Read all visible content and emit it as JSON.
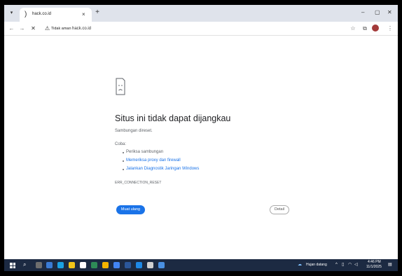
{
  "tab": {
    "title": "hack.co.id",
    "close": "×",
    "new_tab": "+"
  },
  "window": {
    "minimize": "–",
    "maximize": "▢",
    "close": "✕"
  },
  "toolbar": {
    "back": "←",
    "forward": "→",
    "reload": "✕",
    "security_label": "Tidak aman",
    "url": "hack.co.id",
    "bookmark": "☆",
    "extensions": "⧉",
    "menu": "⋮"
  },
  "error": {
    "title": "Situs ini tidak dapat dijangkau",
    "description": "Sambungan direset.",
    "try_label": "Coba:",
    "suggestions": [
      "Periksa sambungan",
      "Memeriksa proxy dan firewall",
      "Jalankan Diagnostik Jaringan Windows"
    ],
    "code": "ERR_CONNECTION_RESET",
    "reload_label": "Muat ulang",
    "details_label": "Detail"
  },
  "taskbar": {
    "weather": "Hujan datang",
    "time": "4:46 PM",
    "date": "11/1/2025",
    "app_colors": [
      "#6e6e6e",
      "#3a7bd5",
      "#1ba1e2",
      "#f0c419",
      "#ffffff",
      "#2e8b57",
      "#f4b400",
      "#4285f4",
      "#2b579a",
      "#1e88e5",
      "#d0d0d0",
      "#4a90e2"
    ]
  }
}
